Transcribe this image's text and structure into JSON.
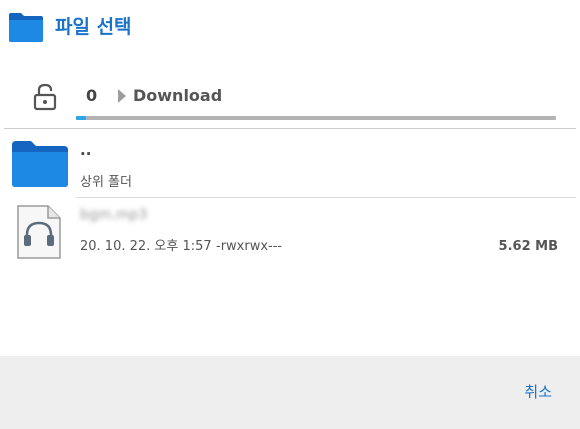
{
  "dialog": {
    "title": "파일 선택",
    "title_icon": "folder-icon",
    "accent_color": "#1a73c8"
  },
  "path_bar": {
    "lock_icon": "lock-open-icon",
    "root": "0",
    "current": "Download",
    "scroll_color": "#2ea6e6"
  },
  "list": {
    "parent": {
      "name": "..",
      "subtitle": "상위 폴더",
      "icon": "folder-icon"
    },
    "file": {
      "name": "bgm.mp3",
      "date": "20. 10. 22. 오후 1:57",
      "permissions": "-rwxrwx---",
      "size": "5.62 MB",
      "icon": "music-file-icon"
    }
  },
  "footer": {
    "cancel_label": "취소"
  }
}
